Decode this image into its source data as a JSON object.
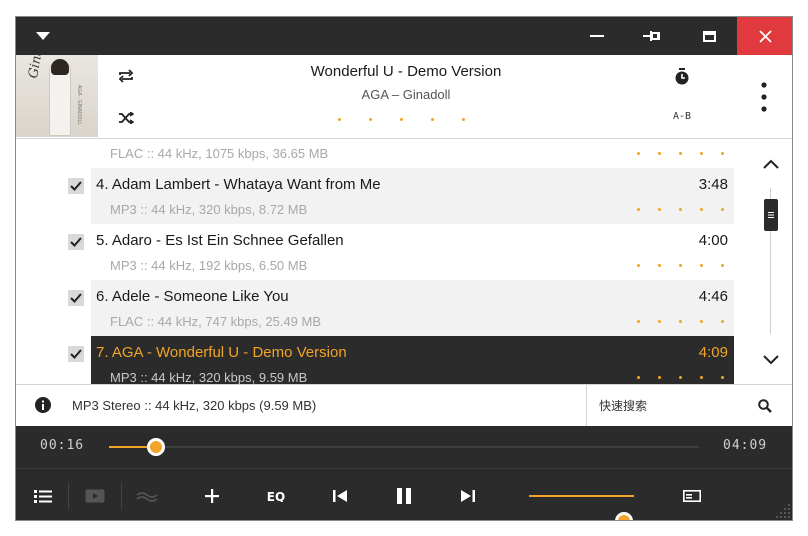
{
  "window": {
    "menu_icon": "chevron-down-icon",
    "minimize_icon": "minimize-icon",
    "pin_icon": "pin-icon",
    "maximize_icon": "maximize-icon",
    "close_icon": "close-icon",
    "close_color": "#e0393e"
  },
  "now_playing": {
    "title": "Wonderful U - Demo Version",
    "artist": "AGA – Ginadoll",
    "cover_script": "Ginadoll",
    "cover_caption": "AGA · GINADOLL",
    "ab_label": "A-B",
    "repeat_icon": "repeat-icon",
    "shuffle_icon": "shuffle-icon",
    "timer_icon": "timer-icon",
    "more_icon": "more-vertical-icon"
  },
  "playlist": {
    "tracks": [
      {
        "title": "",
        "duration": "",
        "meta": "FLAC :: 44 kHz, 1075 kbps, 36.65 MB",
        "checked": false,
        "alt": false,
        "active": false
      },
      {
        "title": "4. Adam Lambert - Whataya Want from Me",
        "duration": "3:48",
        "meta": "MP3 :: 44 kHz, 320 kbps, 8.72 MB",
        "checked": true,
        "alt": true,
        "active": false
      },
      {
        "title": "5. Adaro - Es Ist Ein Schnee Gefallen",
        "duration": "4:00",
        "meta": "MP3 :: 44 kHz, 192 kbps, 6.50 MB",
        "checked": true,
        "alt": false,
        "active": false
      },
      {
        "title": "6. Adele - Someone Like You",
        "duration": "4:46",
        "meta": "FLAC :: 44 kHz, 747 kbps, 25.49 MB",
        "checked": true,
        "alt": true,
        "active": false
      },
      {
        "title": "7. AGA - Wonderful U - Demo Version",
        "duration": "4:09",
        "meta": "MP3 :: 44 kHz, 320 kbps, 9.59 MB",
        "checked": true,
        "alt": false,
        "active": true
      }
    ],
    "scroll_position": 0.1
  },
  "info": {
    "icon": "info-icon",
    "text": "MP3 Stereo  ::  44 kHz, 320 kbps (9.59 MB)",
    "search_placeholder": "快速搜索",
    "search_icon": "search-icon"
  },
  "playback": {
    "elapsed": "00:16",
    "total": "04:09",
    "progress": 0.08,
    "volume": 0.9,
    "accent": "#f1a427",
    "bar_color": "#2b2b2b"
  },
  "toolbar": {
    "icons": [
      "playlist-icon",
      "video-icon",
      "visualizer-icon",
      "add-icon",
      "equalizer-icon",
      "previous-icon",
      "pause-icon",
      "next-icon",
      "miniplayer-icon"
    ],
    "eq_label": "EQ"
  }
}
